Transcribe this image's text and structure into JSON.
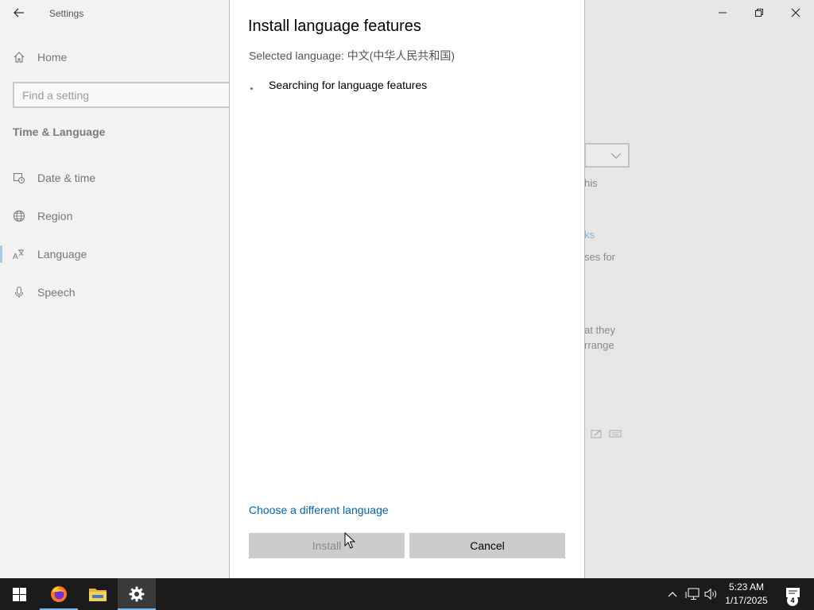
{
  "window": {
    "title": "Settings",
    "controls": {
      "minimize": "minimize",
      "restore": "restore",
      "close": "close"
    }
  },
  "nav": {
    "home_label": "Home",
    "search_placeholder": "Find a setting",
    "section_title": "Time & Language",
    "items": [
      {
        "label": "Date & time",
        "icon": "clock-calendar-icon"
      },
      {
        "label": "Region",
        "icon": "globe-icon"
      },
      {
        "label": "Language",
        "icon": "language-icon",
        "active": true
      },
      {
        "label": "Speech",
        "icon": "microphone-icon"
      }
    ]
  },
  "background_fragments": {
    "line1": "his",
    "line2": "ks",
    "line3": "ses for",
    "line4": "at they",
    "line5": "rrange"
  },
  "dialog": {
    "title": "Install language features",
    "selected_language": "Selected language: 中文(中华人民共和国)",
    "status": "Searching for language features",
    "change_link": "Choose a different language",
    "install_label": "Install",
    "install_enabled": false,
    "cancel_label": "Cancel"
  },
  "taskbar": {
    "apps": [
      {
        "name": "firefox",
        "icon": "firefox-icon",
        "running": true
      },
      {
        "name": "file-explorer",
        "icon": "folder-icon",
        "running": false
      },
      {
        "name": "settings",
        "icon": "gear-icon",
        "running": true,
        "active": true
      }
    ],
    "time": "5:23 AM",
    "date": "1/17/2025",
    "notification_count": "4"
  },
  "colors": {
    "accent": "#0063b1",
    "taskbar": "#1b1b1b",
    "button": "#cccccc",
    "active_indicator": "#76b9ed"
  }
}
